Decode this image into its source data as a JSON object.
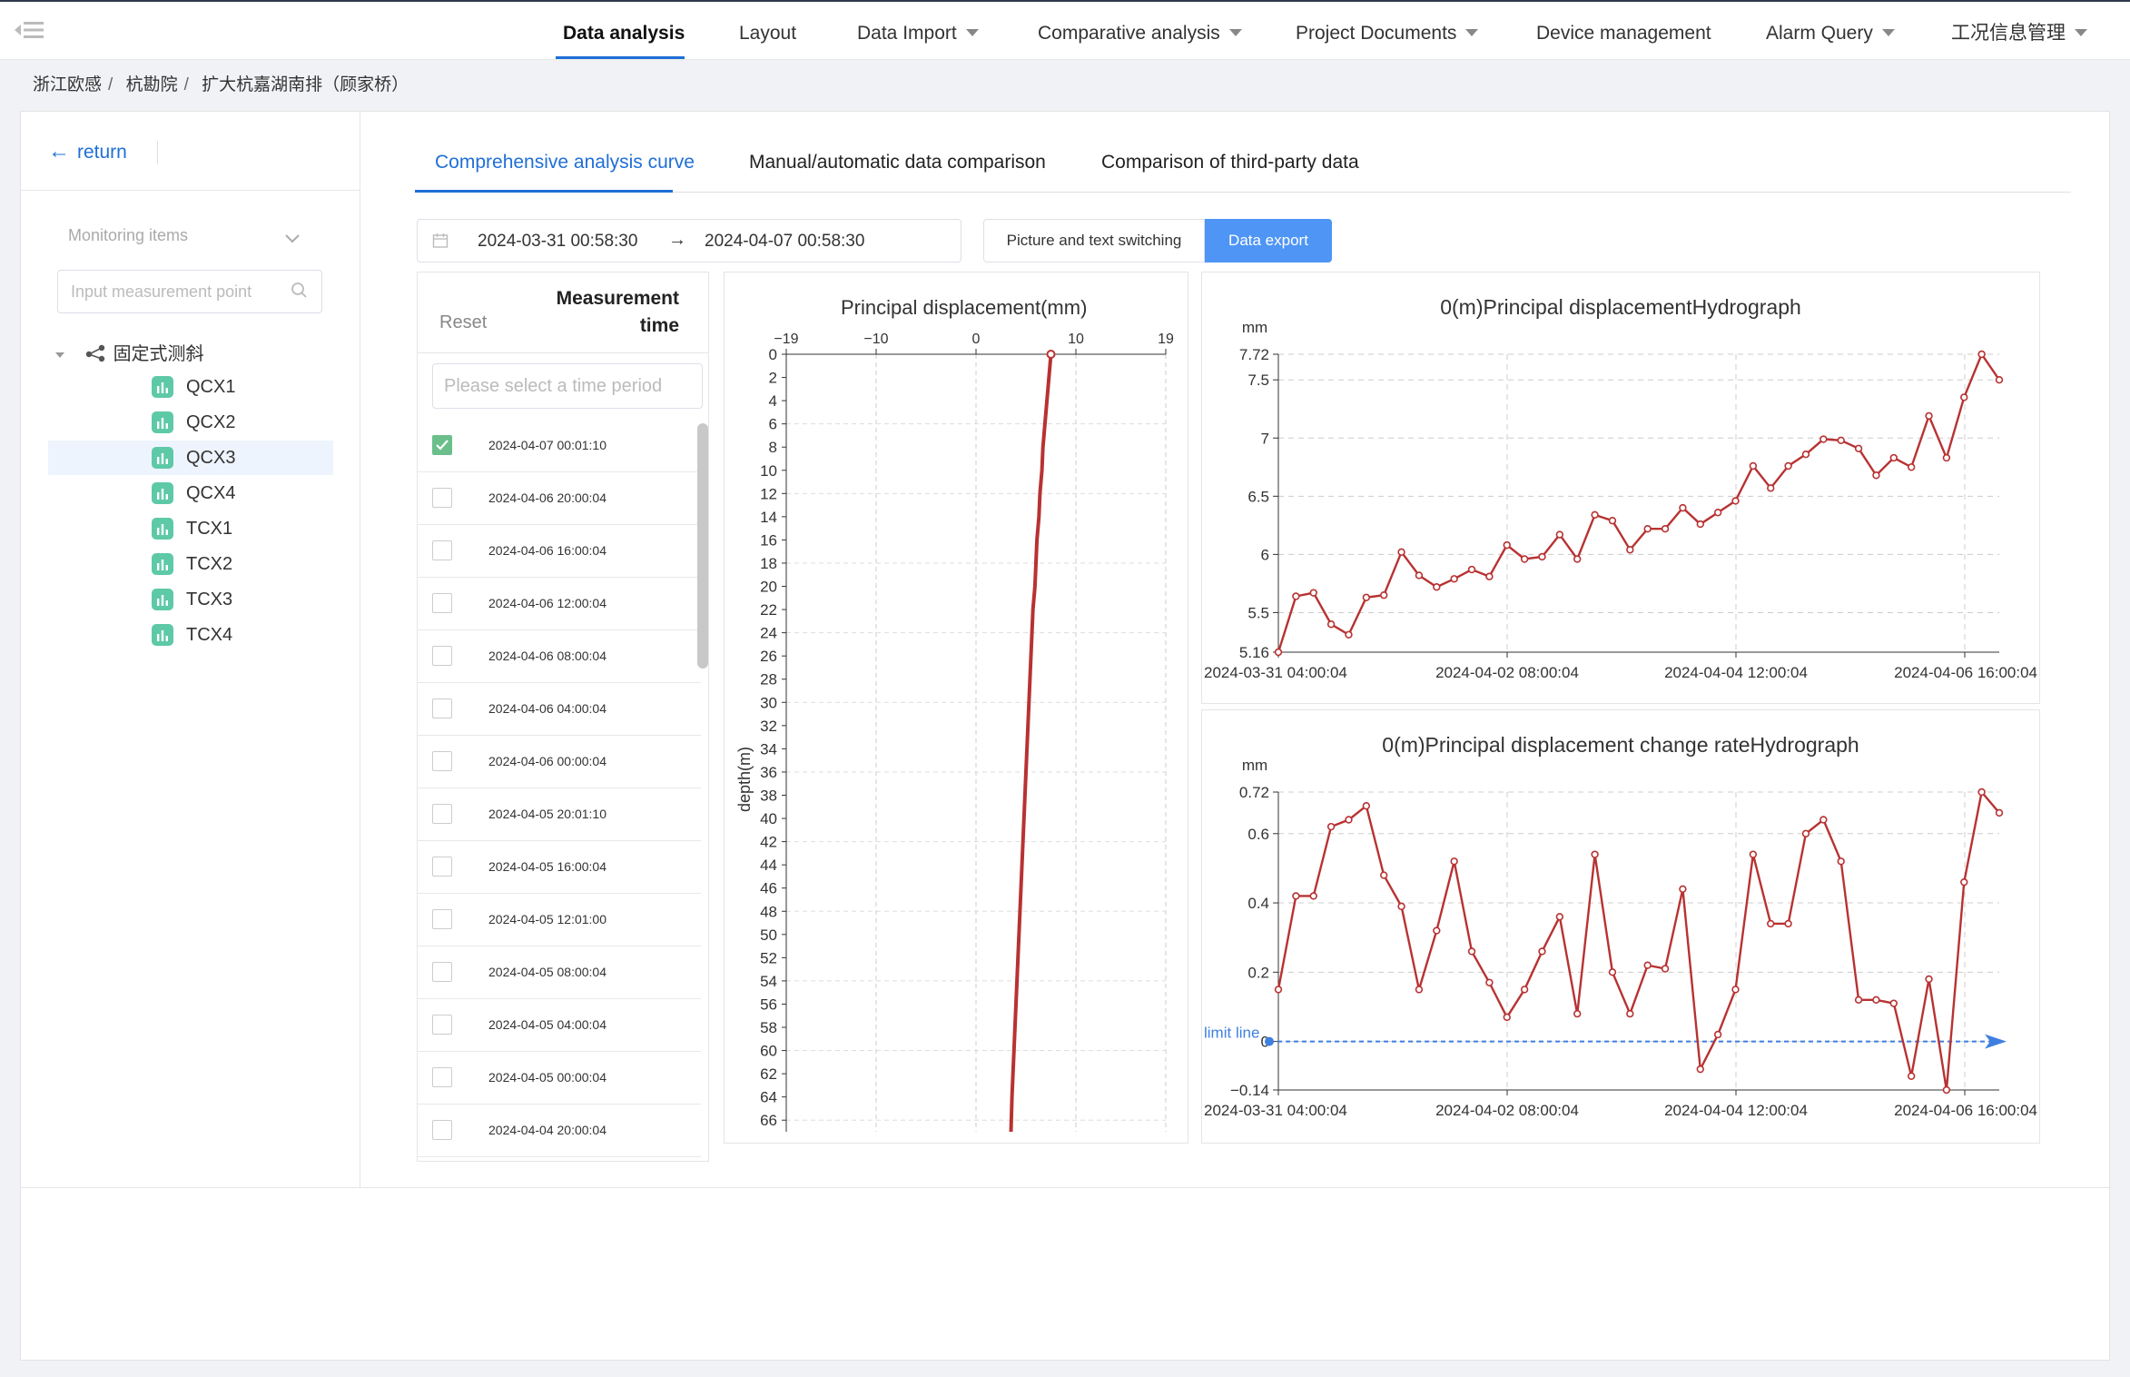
{
  "nav": {
    "items": [
      {
        "label": "Data analysis",
        "caret": false,
        "active": true
      },
      {
        "label": "Layout",
        "caret": false
      },
      {
        "label": "Data Import",
        "caret": true
      },
      {
        "label": "Comparative analysis",
        "caret": true
      },
      {
        "label": "Project Documents",
        "caret": true
      },
      {
        "label": "Device management",
        "caret": false
      },
      {
        "label": "Alarm Query",
        "caret": true
      },
      {
        "label": "工况信息管理",
        "caret": true
      }
    ]
  },
  "breadcrumb": [
    "浙江欧感",
    "杭勘院",
    "扩大杭嘉湖南排（顾家桥）"
  ],
  "sidebar": {
    "return_label": "return",
    "monitoring_label": "Monitoring items",
    "search_placeholder": "Input measurement point",
    "tree_root": "固定式测斜",
    "points": [
      "QCX1",
      "QCX2",
      "QCX3",
      "QCX4",
      "TCX1",
      "TCX2",
      "TCX3",
      "TCX4"
    ],
    "selected_point": "QCX3"
  },
  "tabs": [
    "Comprehensive analysis curve",
    "Manual/automatic data comparison",
    "Comparison of third-party data"
  ],
  "toolbar": {
    "date_start": "2024-03-31 00:58:30",
    "date_arrow": "→",
    "date_end": "2024-04-07 00:58:30",
    "switch_label": "Picture and text switching",
    "export_label": "Data export"
  },
  "time_list": {
    "reset_label": "Reset",
    "header": "Measurement time",
    "filter_placeholder": "Please select a time period",
    "rows": [
      {
        "time": "2024-04-07 00:01:10",
        "checked": true
      },
      {
        "time": "2024-04-06 20:00:04",
        "checked": false
      },
      {
        "time": "2024-04-06 16:00:04",
        "checked": false
      },
      {
        "time": "2024-04-06 12:00:04",
        "checked": false
      },
      {
        "time": "2024-04-06 08:00:04",
        "checked": false
      },
      {
        "time": "2024-04-06 04:00:04",
        "checked": false
      },
      {
        "time": "2024-04-06 00:00:04",
        "checked": false
      },
      {
        "time": "2024-04-05 20:01:10",
        "checked": false
      },
      {
        "time": "2024-04-05 16:00:04",
        "checked": false
      },
      {
        "time": "2024-04-05 12:01:00",
        "checked": false
      },
      {
        "time": "2024-04-05 08:00:04",
        "checked": false
      },
      {
        "time": "2024-04-05 04:00:04",
        "checked": false
      },
      {
        "time": "2024-04-05 00:00:04",
        "checked": false
      },
      {
        "time": "2024-04-04 20:00:04",
        "checked": false
      }
    ]
  },
  "colors": {
    "accent": "#1f6fd6",
    "series": "#b83232",
    "zero_line": "#3f7fe0",
    "export_button": "#4e95f5",
    "point_icon": "#5ec9a7"
  },
  "chart_data": [
    {
      "type": "line",
      "title": "Principal displacement(mm)",
      "ylabel": "depth(m)",
      "xlim": [
        -19,
        19
      ],
      "ylim": [
        0,
        67
      ],
      "y_inverted": true,
      "xticks": [
        "−19",
        "−10",
        "0",
        "10",
        "19"
      ],
      "yticks": [
        0,
        2,
        4,
        6,
        8,
        10,
        12,
        14,
        16,
        18,
        20,
        22,
        24,
        26,
        28,
        30,
        32,
        34,
        36,
        38,
        40,
        42,
        44,
        46,
        48,
        50,
        52,
        54,
        56,
        58,
        60,
        62,
        64,
        66
      ],
      "grid": true,
      "series": [
        {
          "x": [
            7.5,
            7.3,
            7.1,
            6.9,
            6.7,
            6.6,
            6.4,
            6.3,
            6.1,
            6.0,
            5.9,
            5.7,
            5.6,
            5.5,
            5.4,
            5.3,
            5.2,
            5.1,
            5.0,
            4.9,
            4.8,
            4.7,
            4.6,
            4.5,
            4.4,
            4.3,
            4.2,
            4.1,
            4.0,
            3.9,
            3.8,
            3.7,
            3.6,
            3.5
          ],
          "y": [
            0,
            2,
            4,
            6,
            8,
            10,
            12,
            14,
            16,
            18,
            20,
            22,
            24,
            26,
            28,
            30,
            32,
            34,
            36,
            38,
            40,
            42,
            44,
            46,
            48,
            50,
            52,
            54,
            56,
            58,
            60,
            62,
            64,
            67
          ]
        }
      ]
    },
    {
      "type": "line",
      "title": "0(m)Principal displacementHydrograph",
      "ylabel": "mm",
      "ylim": [
        5.16,
        7.72
      ],
      "yticks": [
        "5.16",
        "5.5",
        "6",
        "6.5",
        "7",
        "7.5",
        "7.72"
      ],
      "xticks": [
        "2024-03-31 04:00:04",
        "2024-04-02 08:00:04",
        "2024-04-04 12:00:04",
        "2024-04-06 16:00:04"
      ],
      "grid": true,
      "series": [
        {
          "values": [
            5.16,
            5.64,
            5.67,
            5.4,
            5.31,
            5.63,
            5.65,
            6.02,
            5.82,
            5.72,
            5.79,
            5.87,
            5.81,
            6.08,
            5.96,
            5.98,
            6.17,
            5.96,
            6.34,
            6.29,
            6.04,
            6.22,
            6.22,
            6.4,
            6.26,
            6.36,
            6.46,
            6.76,
            6.57,
            6.76,
            6.86,
            6.99,
            6.98,
            6.91,
            6.68,
            6.83,
            6.75,
            7.19,
            6.83,
            7.35,
            7.72,
            7.5
          ]
        }
      ]
    },
    {
      "type": "line",
      "title": "0(m)Principal displacement change rateHydrograph",
      "ylabel": "mm",
      "ylim": [
        -0.14,
        0.72
      ],
      "yticks": [
        "−0.14",
        "0",
        "0.2",
        "0.4",
        "0.6",
        "0.72"
      ],
      "xticks": [
        "2024-03-31 04:00:04",
        "2024-04-02 08:00:04",
        "2024-04-04 12:00:04",
        "2024-04-06 16:00:04"
      ],
      "grid": true,
      "markline": {
        "label": "limit line",
        "value": 0
      },
      "series": [
        {
          "values": [
            0.15,
            0.42,
            0.42,
            0.62,
            0.64,
            0.68,
            0.48,
            0.39,
            0.15,
            0.32,
            0.52,
            0.26,
            0.17,
            0.07,
            0.15,
            0.26,
            0.36,
            0.08,
            0.54,
            0.2,
            0.08,
            0.22,
            0.21,
            0.44,
            -0.08,
            0.02,
            0.15,
            0.54,
            0.34,
            0.34,
            0.6,
            0.64,
            0.52,
            0.12,
            0.12,
            0.11,
            -0.1,
            0.18,
            -0.14,
            0.46,
            0.72,
            0.66
          ]
        }
      ]
    }
  ]
}
